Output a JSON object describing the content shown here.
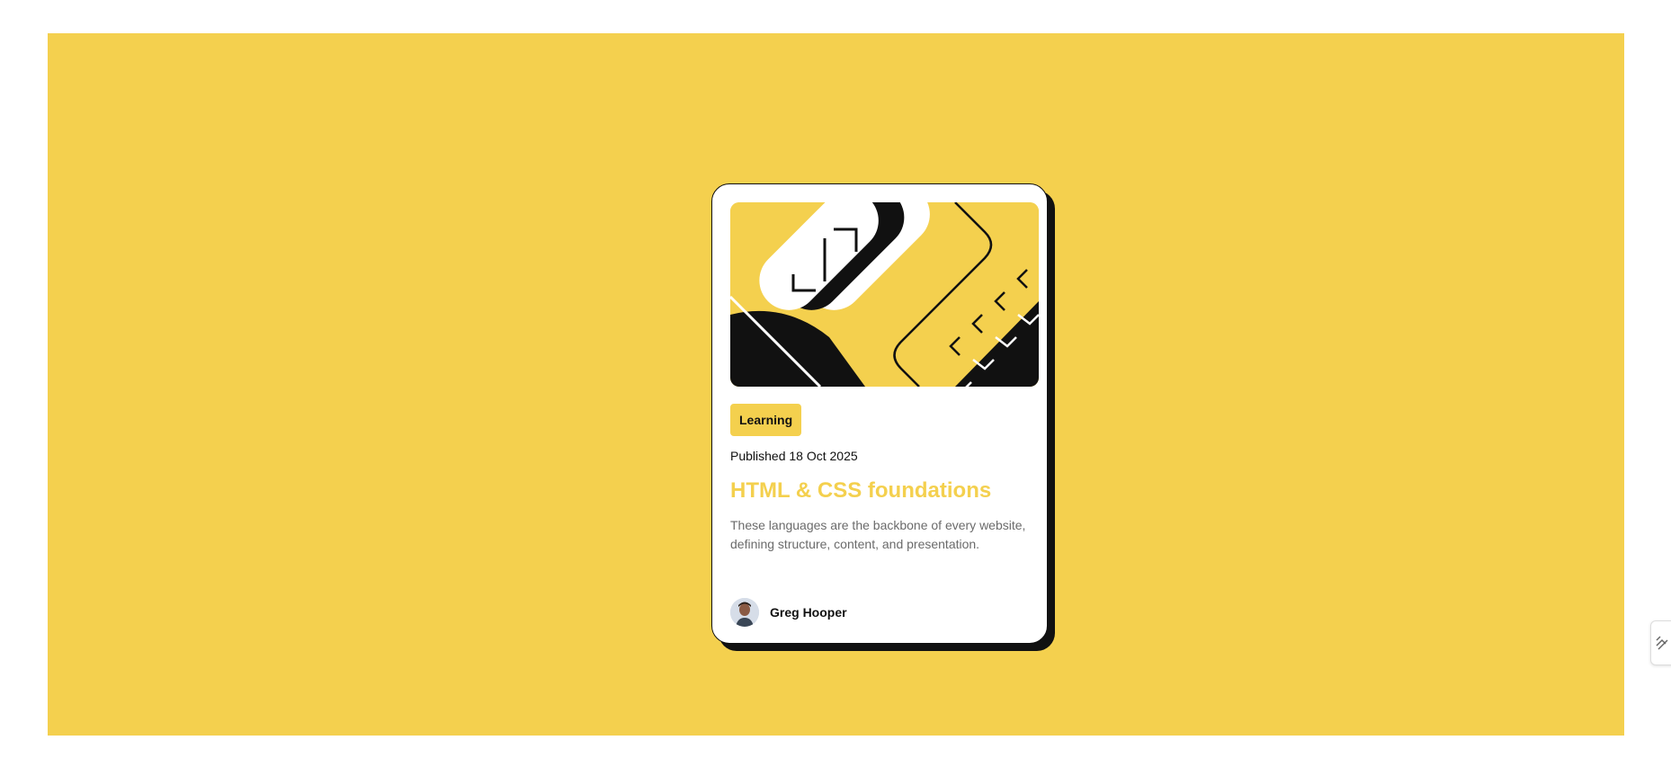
{
  "card": {
    "tag": "Learning",
    "published": "Published 18 Oct 2025",
    "title": "HTML & CSS foundations",
    "description": "These languages are the backbone of every website, defining structure, content, and presentation.",
    "author": {
      "name": "Greg Hooper"
    }
  },
  "colors": {
    "background": "#f4d04e",
    "card": "#ffffff",
    "ink": "#111111",
    "muted_text": "#6b6b6b"
  },
  "icons": {
    "hero": "illustration-image",
    "avatar": "avatar-photo",
    "side_handle": "expand-handle-icon"
  }
}
